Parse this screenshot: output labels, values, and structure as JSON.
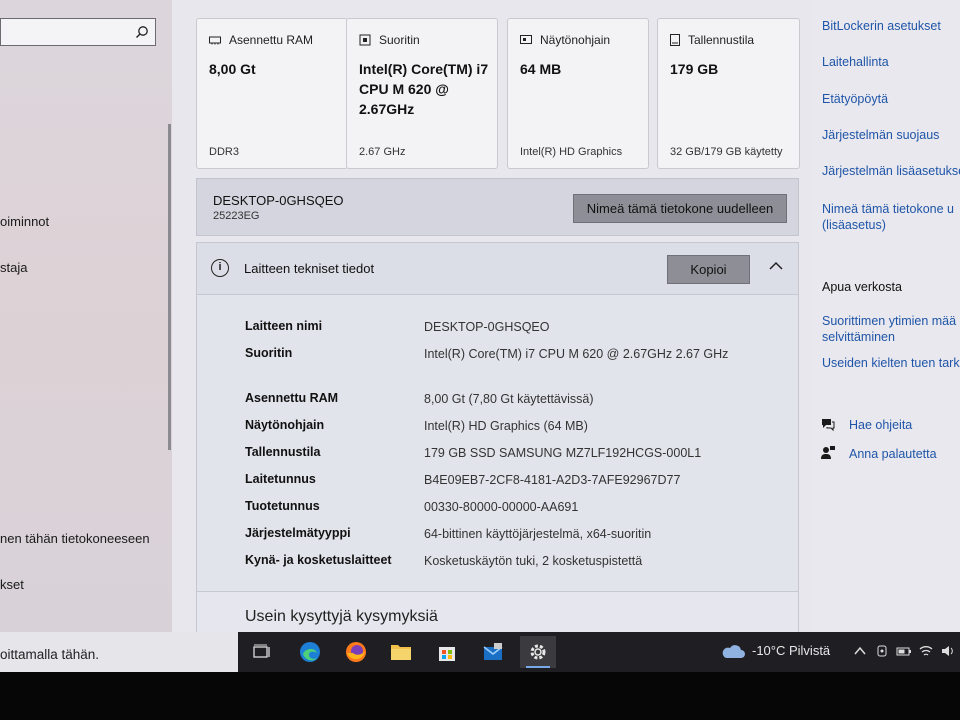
{
  "sidebar": {
    "items": [
      "oiminnot",
      "staja",
      "nen tähän tietokoneeseen",
      "kset"
    ]
  },
  "cards": [
    {
      "icon": "ram-icon",
      "label": "Asennettu RAM",
      "value": "8,00 Gt",
      "sub": "DDR3"
    },
    {
      "icon": "cpu-icon",
      "label": "Suoritin",
      "value": "Intel(R) Core(TM) i7 CPU M 620 @ 2.67GHz",
      "sub": "2.67 GHz"
    },
    {
      "icon": "gpu-icon",
      "label": "Näytönohjain",
      "value": "64 MB",
      "sub": "Intel(R) HD Graphics"
    },
    {
      "icon": "storage-icon",
      "label": "Tallennustila",
      "value": "179 GB",
      "sub": "32 GB/179 GB käytetty"
    }
  ],
  "device": {
    "name": "DESKTOP-0GHSQEO",
    "model": "25223EG",
    "rename_label": "Nimeä tämä tietokone uudelleen"
  },
  "specs": {
    "title": "Laitteen tekniset tiedot",
    "copy_label": "Kopioi",
    "rows": [
      {
        "k": "Laitteen nimi",
        "v": "DESKTOP-0GHSQEO"
      },
      {
        "k": "Suoritin",
        "v": "Intel(R) Core(TM) i7 CPU M 620 @ 2.67GHz 2.67 GHz"
      },
      {
        "k": "Asennettu RAM",
        "v": "8,00 Gt (7,80 Gt käytettävissä)"
      },
      {
        "k": "Näytönohjain",
        "v": "Intel(R) HD Graphics (64 MB)"
      },
      {
        "k": "Tallennustila",
        "v": "179 GB SSD SAMSUNG MZ7LF192HCGS-000L1"
      },
      {
        "k": "Laitetunnus",
        "v": "B4E09EB7-2CF8-4181-A2D3-7AFE92967D77"
      },
      {
        "k": "Tuotetunnus",
        "v": "00330-80000-00000-AA691"
      },
      {
        "k": "Järjestelmätyyppi",
        "v": "64-bittinen käyttöjärjestelmä, x64-suoritin"
      },
      {
        "k": "Kynä- ja kosketuslaitteet",
        "v": "Kosketuskäytön tuki, 2 kosketuspistettä"
      }
    ],
    "faq_title": "Usein kysyttyjä kysymyksiä"
  },
  "related": {
    "links": [
      "BitLockerin asetukset",
      "Laitehallinta",
      "Etätyöpöytä",
      "Järjestelmän suojaus",
      "Järjestelmän lisäasetukse",
      "Nimeä tämä tietokone u (lisäasetus)"
    ],
    "help_title": "Apua verkosta",
    "help_links": [
      "Suorittimen ytimien mää selvittäminen",
      "Useiden kielten tuen tark"
    ],
    "actions": [
      {
        "icon": "help-chat-icon",
        "label": "Hae ohjeita"
      },
      {
        "icon": "feedback-icon",
        "label": "Anna palautetta"
      }
    ]
  },
  "taskbar": {
    "search_text": "oittamalla tähän.",
    "apps": [
      "task-view-icon",
      "edge-icon",
      "firefox-icon",
      "file-explorer-icon",
      "store-icon",
      "mail-icon",
      "settings-icon"
    ],
    "weather": "-10°C  Pilvistä"
  },
  "colors": {
    "link": "#1f55a8",
    "button": "#8e8f96",
    "taskbar": "#1f1f23"
  }
}
